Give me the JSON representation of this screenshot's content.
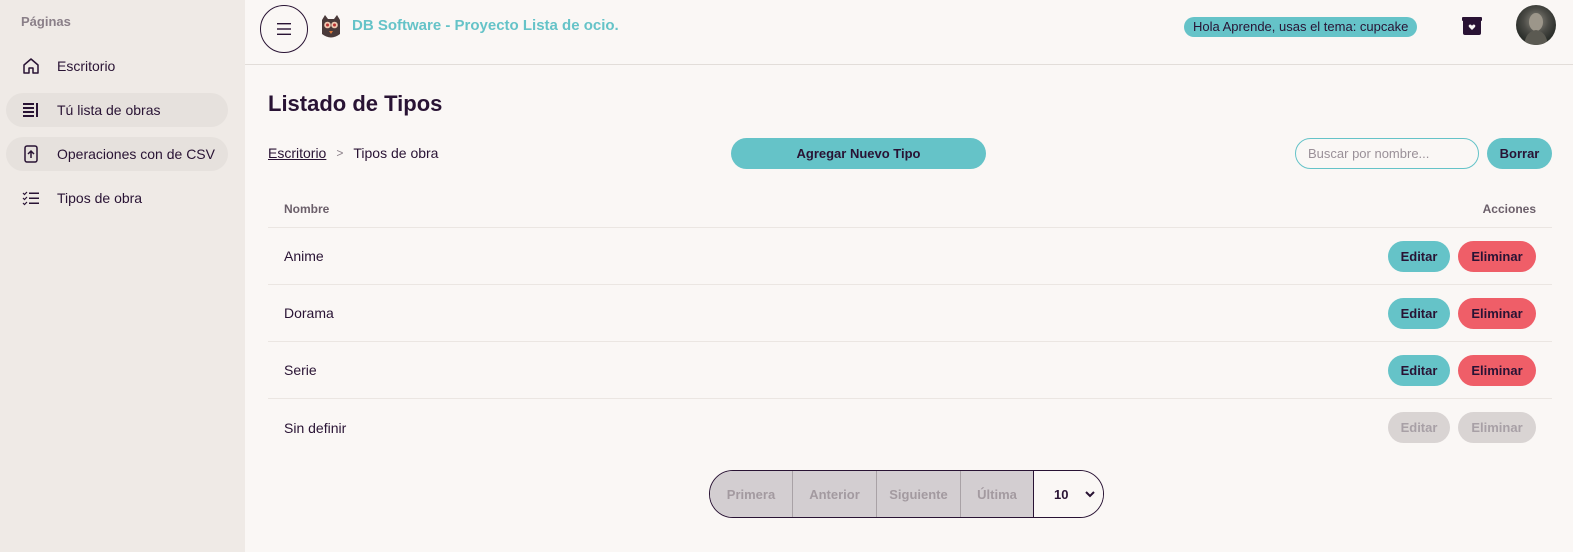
{
  "sidebar": {
    "title": "Páginas",
    "items": [
      {
        "label": "Escritorio",
        "icon": "home-icon"
      },
      {
        "label": "Tú lista de obras",
        "icon": "list-icon"
      },
      {
        "label": "Operaciones con de CSV",
        "icon": "upload-file-icon"
      },
      {
        "label": "Tipos de obra",
        "icon": "list-check-icon"
      }
    ]
  },
  "header": {
    "app_title": "DB Software - Proyecto Lista de ocio.",
    "greeting": "Hola Aprende, usas el tema: cupcake"
  },
  "main": {
    "page_title": "Listado de Tipos",
    "breadcrumb": {
      "home": "Escritorio",
      "sep": ">",
      "current": "Tipos de obra"
    },
    "add_button": "Agregar Nuevo Tipo",
    "search_placeholder": "Buscar por nombre...",
    "clear_button": "Borrar",
    "table": {
      "col_name": "Nombre",
      "col_actions": "Acciones",
      "rows": [
        {
          "name": "Anime",
          "edit": "Editar",
          "delete": "Eliminar"
        },
        {
          "name": "Dorama",
          "edit": "Editar",
          "delete": "Eliminar"
        },
        {
          "name": "Serie",
          "edit": "Editar",
          "delete": "Eliminar"
        },
        {
          "name": "Sin definir",
          "edit": "Editar",
          "delete": "Eliminar"
        }
      ]
    },
    "pagination": {
      "first": "Primera",
      "prev": "Anterior",
      "next": "Siguiente",
      "last": "Última",
      "per_page": "10"
    }
  },
  "colors": {
    "primary": "#65c3c8",
    "danger": "#ef5e68",
    "text": "#291334",
    "bg": "#faf7f5"
  }
}
